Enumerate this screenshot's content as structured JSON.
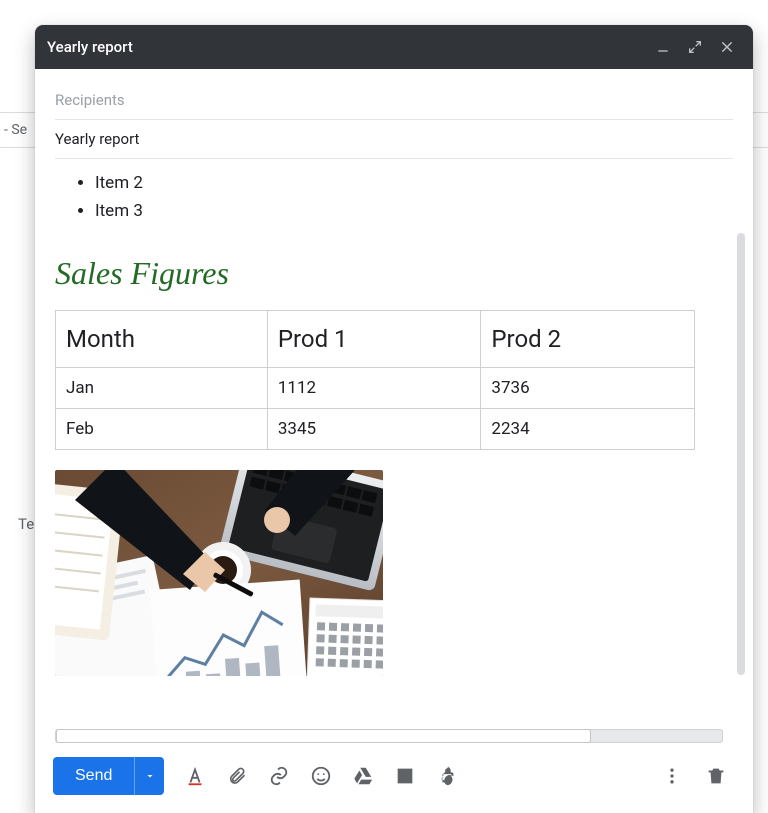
{
  "background": {
    "search_fragment": "- Se",
    "te_fragment": "Te"
  },
  "compose": {
    "window_title": "Yearly report",
    "recipients_placeholder": "Recipients",
    "subject_value": "Yearly report",
    "list": {
      "item1": "Item 2",
      "item2": "Item 3"
    },
    "section_title": "Sales Figures",
    "table": {
      "headers": {
        "c0": "Month",
        "c1": "Prod 1",
        "c2": "Prod 2"
      },
      "rows": [
        {
          "c0": "Jan",
          "c1": "1112",
          "c2": "3736"
        },
        {
          "c0": "Feb",
          "c1": "3345",
          "c2": "2234"
        }
      ]
    },
    "image_alt": "desk-with-laptop-coffee-papers"
  },
  "footer": {
    "send_label": "Send"
  },
  "chart_data": {
    "type": "table",
    "title": "Sales Figures",
    "headers": [
      "Month",
      "Prod 1",
      "Prod 2"
    ],
    "rows": [
      [
        "Jan",
        1112,
        3736
      ],
      [
        "Feb",
        3345,
        2234
      ]
    ]
  }
}
